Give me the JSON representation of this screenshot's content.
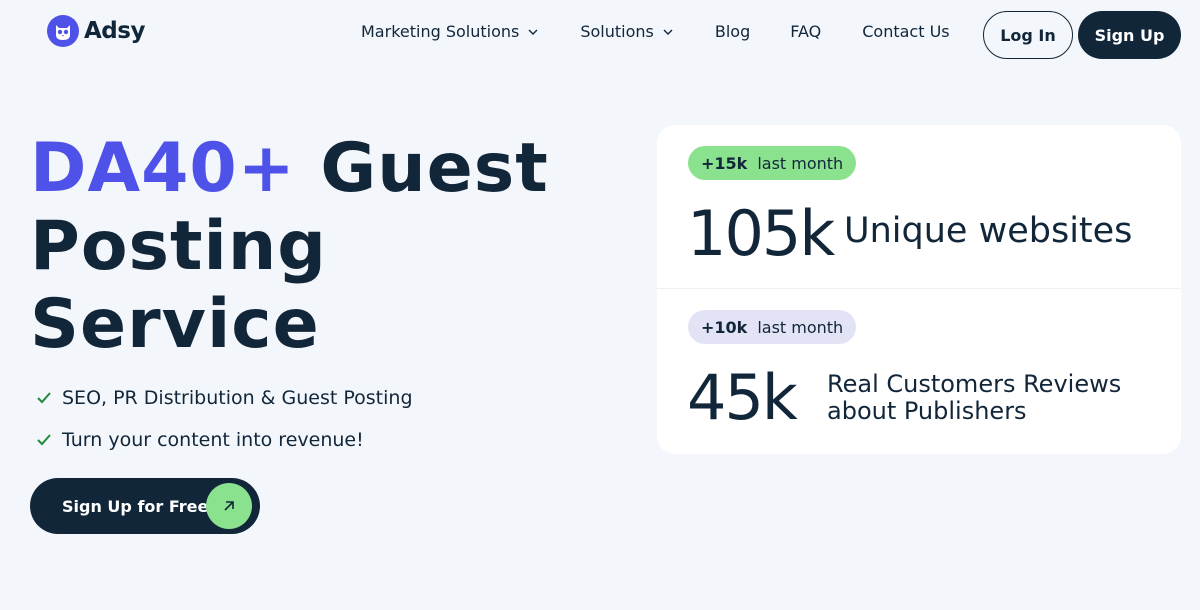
{
  "brand": {
    "name": "Adsy",
    "accent_color": "#4f52e8",
    "dark_color": "#12263a",
    "green_color": "#8be28e"
  },
  "nav": {
    "items": [
      {
        "label": "Marketing Solutions",
        "has_dropdown": true
      },
      {
        "label": "Solutions",
        "has_dropdown": true
      },
      {
        "label": "Blog",
        "has_dropdown": false
      },
      {
        "label": "FAQ",
        "has_dropdown": false
      },
      {
        "label": "Contact Us",
        "has_dropdown": false
      }
    ],
    "login_label": "Log In",
    "signup_label": "Sign Up"
  },
  "hero": {
    "title_accent": "DA40+",
    "title_line1_rest": "Guest",
    "title_line2": "Posting",
    "title_line3": "Service",
    "features": [
      "SEO, PR Distribution & Guest Posting",
      "Turn your content into revenue!"
    ],
    "cta_label": "Sign Up for Free"
  },
  "stats": [
    {
      "badge_value": "+15k",
      "badge_text": "last month",
      "number": "105k",
      "label": "Unique websites"
    },
    {
      "badge_value": "+10k",
      "badge_text": "last month",
      "number": "45k",
      "label": "Real Customers Reviews about Publishers"
    }
  ]
}
